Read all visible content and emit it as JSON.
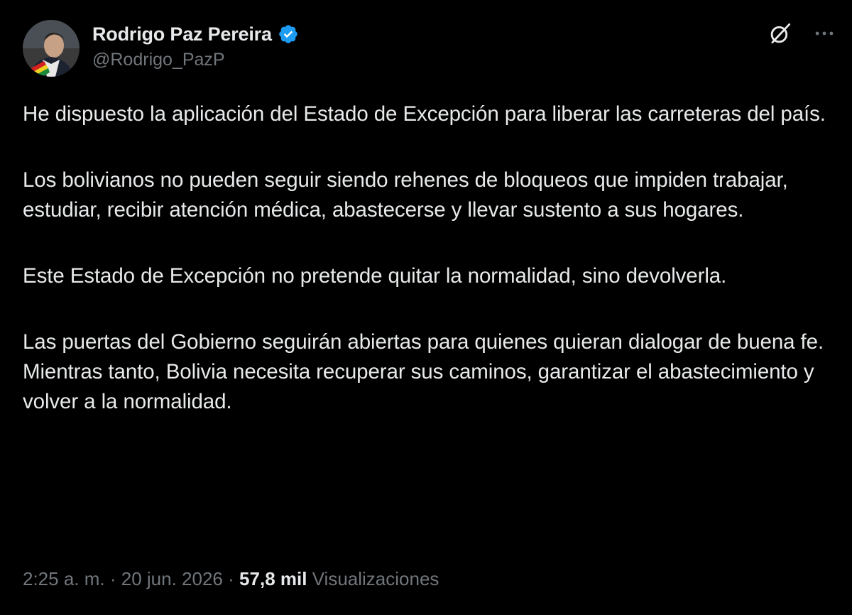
{
  "author": {
    "display_name": "Rodrigo Paz Pereira",
    "handle": "@Rodrigo_PazP",
    "verified": true,
    "verified_color": "#1d9bf0"
  },
  "actions": {
    "grok_icon": "grok-icon",
    "more_icon": "more-horizontal-icon"
  },
  "tweet": {
    "paragraphs": [
      "He dispuesto la aplicación del Estado de Excepción para liberar las carreteras del país.",
      "Los bolivianos no pueden seguir siendo rehenes de bloqueos que impiden trabajar, estudiar, recibir atención médica, abastecerse y llevar sustento a sus hogares.",
      "Este Estado de Excepción no pretende quitar la normalidad, sino devolverla.",
      "Las puertas del Gobierno seguirán abiertas para quienes quieran dialogar de buena fe. Mientras tanto, Bolivia necesita recuperar sus caminos, garantizar el abastecimiento y volver a la normalidad."
    ]
  },
  "meta": {
    "time": "2:25 a. m.",
    "separator": "·",
    "date": "20 jun. 2026",
    "views_count": "57,8 mil",
    "views_label": "Visualizaciones"
  },
  "colors": {
    "background": "#000000",
    "primary_text": "#e7e9ea",
    "secondary_text": "#71767b"
  }
}
